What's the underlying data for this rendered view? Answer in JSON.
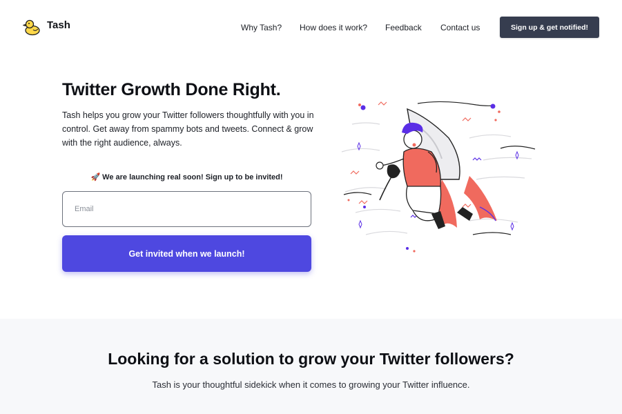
{
  "nav": {
    "brand": "Tash",
    "logo_icon": "duck-logo-icon",
    "links": [
      {
        "label": "Why Tash?"
      },
      {
        "label": "How does it work?"
      },
      {
        "label": "Feedback"
      },
      {
        "label": "Contact us"
      }
    ],
    "cta_label": "Sign up & get notified!"
  },
  "hero": {
    "title": "Twitter Growth Done Right.",
    "description": "Tash helps you grow your Twitter followers thoughtfully with you in control. Get away from spammy bots and tweets. Connect & grow with the right audience, always.",
    "launch_icon": "🚀",
    "launch_note": "We are launching real soon! Sign up to be invited!",
    "email_placeholder": "Email",
    "submit_label": "Get invited when we launch!",
    "illustration": "rocket-person-illustration"
  },
  "section2": {
    "title": "Looking for a solution to grow your Twitter followers?",
    "subtitle": "Tash is your thoughtful sidekick when it comes to growing your Twitter influence."
  },
  "colors": {
    "accent": "#4e48e0",
    "nav_button": "#363d4f",
    "illustration_red": "#f06a5e",
    "hair_purple": "#5a2ee6",
    "section_bg": "#f7f8fa"
  }
}
